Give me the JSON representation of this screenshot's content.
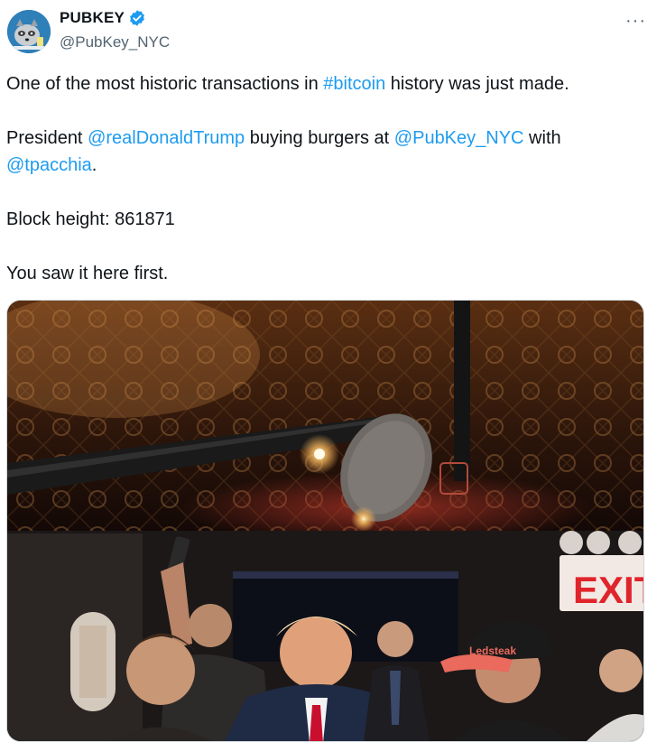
{
  "author": {
    "display_name": "PUBKEY",
    "handle": "@PubKey_NYC",
    "verified": true,
    "avatar_icon": "raccoon-avatar-icon"
  },
  "more_icon": "ellipsis-icon",
  "more_label": "···",
  "tweet": {
    "line1_before": "One of the most historic transactions in ",
    "line1_hashtag": "#bitcoin",
    "line1_after": " history was just made.",
    "line2_before": "President ",
    "mention1": "@realDonaldTrump",
    "line2_mid": " buying burgers at ",
    "mention2": "@PubKey_NYC",
    "line2_after": " with",
    "mention3": "@tpacchia",
    "line3_after": ".",
    "line4": "Block height: 861871",
    "line5": "You saw it here first."
  },
  "media": {
    "exit_sign": "EXIT",
    "cap_text": "Ledsteak"
  },
  "colors": {
    "link": "#1d9bf0",
    "verified": "#1d9bf0",
    "exit_red": "#e0242b"
  }
}
